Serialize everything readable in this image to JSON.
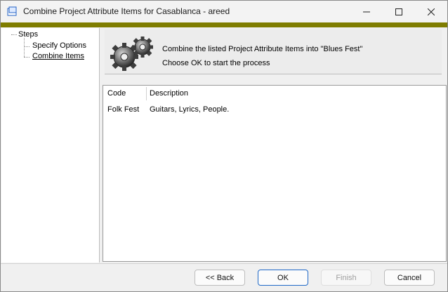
{
  "window": {
    "title": "Combine Project Attribute Items for Casablanca - areed"
  },
  "steps": {
    "root": "Steps",
    "items": [
      {
        "label": "Specify Options"
      },
      {
        "label": "Combine Items"
      }
    ]
  },
  "header": {
    "message_line1": "Combine the listed Project Attribute Items into \"Blues Fest\"",
    "message_line2": "Choose OK to start the process"
  },
  "table": {
    "columns": [
      "Code",
      "Description"
    ],
    "rows": [
      {
        "code": "Folk Fest",
        "description": "Guitars, Lyrics, People."
      }
    ]
  },
  "buttons": {
    "back": "<< Back",
    "ok": "OK",
    "finish": "Finish",
    "cancel": "Cancel"
  },
  "colors": {
    "accent": "#7f7d00",
    "primary_border": "#1f68c7"
  },
  "icons": {
    "app": "window-icon",
    "header": "gears-icon",
    "minimize": "minimize-icon",
    "maximize": "maximize-icon",
    "close": "close-icon"
  }
}
